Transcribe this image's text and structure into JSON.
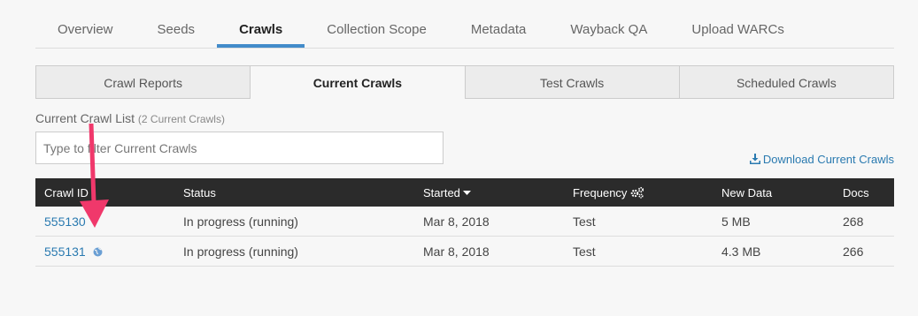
{
  "topnav": {
    "tabs": [
      {
        "label": "Overview"
      },
      {
        "label": "Seeds"
      },
      {
        "label": "Crawls"
      },
      {
        "label": "Collection Scope"
      },
      {
        "label": "Metadata"
      },
      {
        "label": "Wayback QA"
      },
      {
        "label": "Upload WARCs"
      }
    ],
    "active": "Crawls"
  },
  "subtabs": [
    {
      "label": "Crawl Reports"
    },
    {
      "label": "Current Crawls"
    },
    {
      "label": "Test Crawls"
    },
    {
      "label": "Scheduled Crawls"
    }
  ],
  "list": {
    "title": "Current Crawl List",
    "count": "(2 Current Crawls)",
    "filter_placeholder": "Type to filter Current Crawls",
    "download_label": "Download Current Crawls"
  },
  "table": {
    "headers": [
      "Crawl ID",
      "Status",
      "Started",
      "Frequency",
      "New Data",
      "Docs"
    ],
    "rows": [
      {
        "id": "555130",
        "status": "In progress (running)",
        "started": "Mar 8, 2018",
        "frequency": "Test",
        "new_data": "5 MB",
        "docs": "268"
      },
      {
        "id": "555131",
        "status": "In progress (running)",
        "started": "Mar 8, 2018",
        "frequency": "Test",
        "new_data": "4.3 MB",
        "docs": "266"
      }
    ]
  },
  "colors": {
    "accent": "#428bca",
    "link": "#2a7ab0",
    "table_header_bg": "#2b2b2b",
    "annotation_arrow": "#f0386b"
  },
  "icons": [
    "download-icon",
    "sort-caret-icon",
    "gears-icon",
    "globe-icon",
    "annotation-arrow"
  ]
}
